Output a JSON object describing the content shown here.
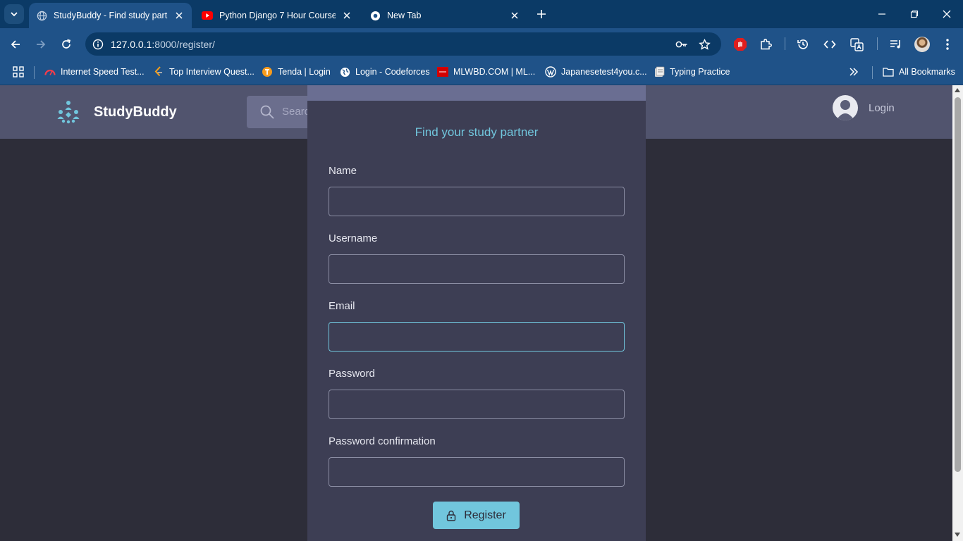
{
  "browser": {
    "tabs": [
      {
        "title": "StudyBuddy - Find study partne",
        "favicon": "globe-icon",
        "active": true
      },
      {
        "title": "Python Django 7 Hour Course -",
        "favicon": "youtube-icon",
        "active": false
      },
      {
        "title": "New Tab",
        "favicon": "chrome-icon",
        "active": false
      }
    ],
    "url_host": "127.0.0.1",
    "url_path": ":8000/register/",
    "bookmarks": [
      {
        "label": "Internet Speed Test...",
        "icon": "speedometer-icon"
      },
      {
        "label": "Top Interview Quest...",
        "icon": "leetcode-icon"
      },
      {
        "label": "Tenda | Login",
        "icon": "tenda-icon"
      },
      {
        "label": "Login - Codeforces",
        "icon": "globe-icon"
      },
      {
        "label": "MLWBD.COM | ML...",
        "icon": "mlwbd-icon"
      },
      {
        "label": "Japanesetest4you.c...",
        "icon": "wordpress-icon"
      },
      {
        "label": "Typing Practice",
        "icon": "keyboard-icon"
      }
    ],
    "all_bookmarks_label": "All Bookmarks"
  },
  "site": {
    "brand": "StudyBuddy",
    "search_placeholder": "Search",
    "login_label": "Login"
  },
  "form": {
    "subtitle": "Find your study partner",
    "fields": [
      {
        "label": "Name",
        "value": ""
      },
      {
        "label": "Username",
        "value": ""
      },
      {
        "label": "Email",
        "value": ""
      },
      {
        "label": "Password",
        "value": ""
      },
      {
        "label": "Password confirmation",
        "value": ""
      }
    ],
    "submit_label": "Register"
  },
  "colors": {
    "accent": "#71c6dd",
    "header_bg": "#51546e",
    "card_bg": "#3d3e54",
    "page_bg": "#2d2d39",
    "browser_frame": "#1f5288"
  }
}
